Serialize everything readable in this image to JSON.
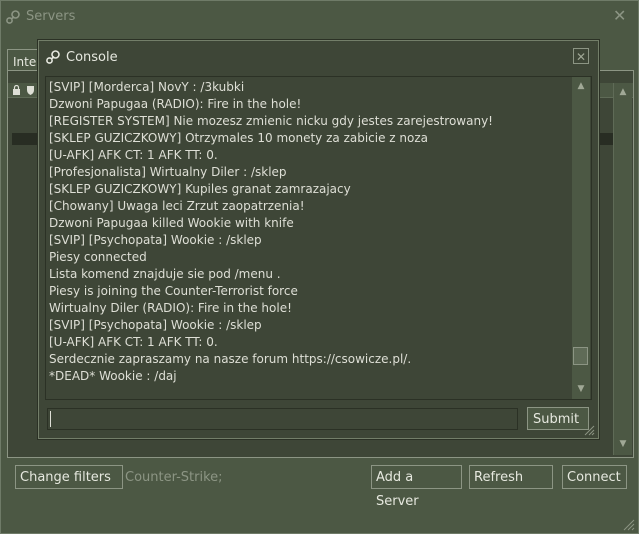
{
  "window": {
    "title": "Servers",
    "tab_label": "Inter",
    "game_filter_label": "Counter-Strike;"
  },
  "buttons": {
    "change_filters": "Change filters",
    "add_server": "Add a Server",
    "refresh": "Refresh",
    "connect": "Connect"
  },
  "console": {
    "title": "Console",
    "submit": "Submit",
    "input_value": "",
    "lines": [
      "[SVIP] [Morderca] NovY :  /3kubki",
      "Dzwoni Papugaa (RADIO): Fire in the hole!",
      "[REGISTER SYSTEM] Nie mozesz zmienic nicku gdy jestes zarejestrowany!",
      "[SKLEP GUZICZKOWY] Otrzymales 10 monety za zabicie z noza",
      "[U-AFK] AFK CT: 1 AFK TT: 0.",
      "[Profesjonalista] Wirtualny Diler :  /sklep",
      "[SKLEP GUZICZKOWY] Kupiles granat zamrazajacy",
      "[Chowany] Uwaga leci Zrzut zaopatrzenia!",
      "Dzwoni Papugaa killed Wookie with knife",
      "[SVIP] [Psychopata] Wookie :  /sklep",
      "Piesy connected",
      "Lista komend znajduje sie pod /menu .",
      "Piesy is joining the Counter-Terrorist force",
      "Wirtualny Diler (RADIO): Fire in the hole!",
      "[SVIP] [Psychopata] Wookie :  /sklep",
      "[U-AFK] AFK CT: 1 AFK TT: 0.",
      "Serdecznie zapraszamy na nasze forum https://csowicze.pl/.",
      "*DEAD* Wookie :  /daj"
    ]
  },
  "icons": {
    "app_logo": "steam-logo-icon",
    "close": "close-icon",
    "lock": "lock-icon",
    "shield": "shield-icon",
    "scroll_up": "arrow-up-icon",
    "scroll_down": "arrow-down-icon",
    "resize": "resize-grip-icon"
  },
  "colors": {
    "background": "#4c5844",
    "panel": "#3e4637",
    "text": "#dedfd6",
    "muted_text": "#8c9584",
    "border": "#8c9584"
  }
}
